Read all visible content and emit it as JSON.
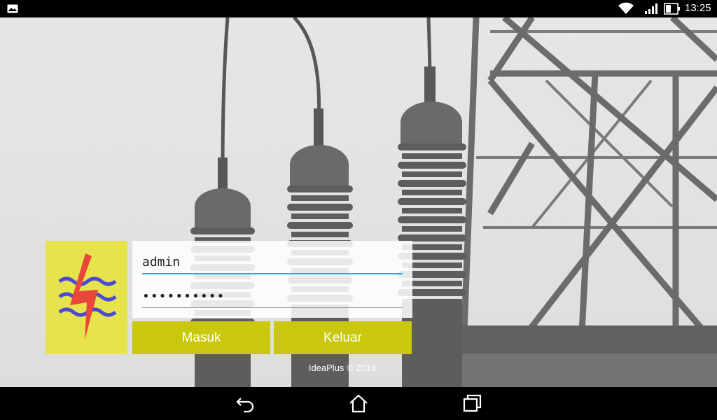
{
  "status_bar": {
    "time": "13:25",
    "icons": [
      "gallery-icon",
      "wifi-icon",
      "signal-icon",
      "battery-icon"
    ]
  },
  "login": {
    "username_value": "admin",
    "password_value": "••••••••••",
    "login_button": "Masuk",
    "exit_button": "Keluar",
    "footer": "IdeaPlus © 2014"
  },
  "navigation": {
    "icons": [
      "back-icon",
      "home-icon",
      "recent-apps-icon"
    ]
  },
  "colors": {
    "logo_bg": "#e7e34c",
    "button_bg": "#c9c80f",
    "input_underline_active": "#2aa7c4"
  }
}
